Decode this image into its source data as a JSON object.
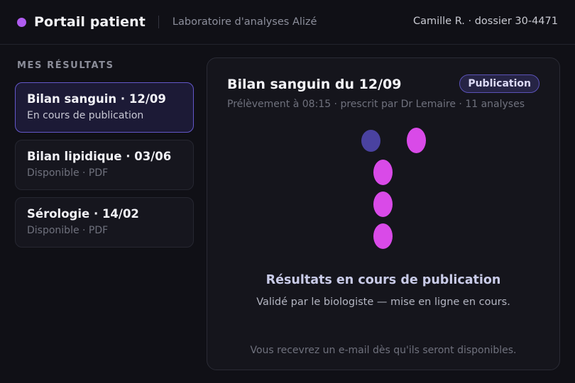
{
  "header": {
    "brand_title": "Portail patient",
    "lab_name": "Laboratoire d'analyses Alizé",
    "user_info": "Camille R. · dossier 30-4471",
    "brand_color": "#b05cf0"
  },
  "sidebar": {
    "section_title": "MES RÉSULTATS",
    "items": [
      {
        "title": "Bilan sanguin · 12/09",
        "subtitle": "En cours de publication",
        "active": true
      },
      {
        "title": "Bilan lipidique · 03/06",
        "subtitle": "Disponible · PDF",
        "active": false
      },
      {
        "title": "Sérologie · 14/02",
        "subtitle": "Disponible · PDF",
        "active": false
      }
    ]
  },
  "main": {
    "title": "Bilan sanguin du 12/09",
    "badge": "Publication",
    "meta": "Prélèvement à 08:15 · prescrit par Dr Lemaire · 11 analyses",
    "loader_icon": "loading-dots-icon",
    "status_title": "Résultats en cours de publication",
    "status_subtitle": "Validé par le biologiste — mise en ligne en cours.",
    "status_note": "Vous recevrez un e-mail dès qu'ils seront disponibles."
  },
  "colors": {
    "accent": "#6357c9",
    "loader_dim": "#4a42a0",
    "loader_bright": "#d94ae8"
  }
}
